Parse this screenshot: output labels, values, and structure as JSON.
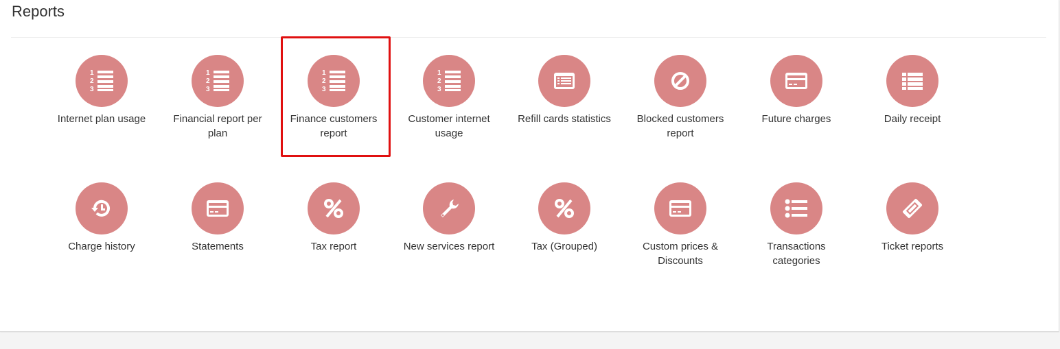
{
  "page": {
    "title": "Reports"
  },
  "reports": [
    {
      "label": "Internet plan usage",
      "icon": "ordered-list-icon"
    },
    {
      "label": "Financial report per plan",
      "icon": "ordered-list-icon"
    },
    {
      "label": "Finance customers report",
      "icon": "ordered-list-icon"
    },
    {
      "label": "Customer internet usage",
      "icon": "ordered-list-icon"
    },
    {
      "label": "Refill cards statistics",
      "icon": "list-alt-icon"
    },
    {
      "label": "Blocked customers report",
      "icon": "ban-icon"
    },
    {
      "label": "Future charges",
      "icon": "credit-card-icon"
    },
    {
      "label": "Daily receipt",
      "icon": "list-icon"
    },
    {
      "label": "Charge history",
      "icon": "history-icon"
    },
    {
      "label": "Statements",
      "icon": "credit-card-icon"
    },
    {
      "label": "Tax report",
      "icon": "percent-icon"
    },
    {
      "label": "New services report",
      "icon": "wrench-icon"
    },
    {
      "label": "Tax (Grouped)",
      "icon": "percent-icon"
    },
    {
      "label": "Custom prices & Discounts",
      "icon": "credit-card-icon"
    },
    {
      "label": "Transactions categories",
      "icon": "list-ul-icon"
    },
    {
      "label": "Ticket reports",
      "icon": "ticket-icon"
    }
  ],
  "selected": "Finance customers report",
  "colors": {
    "icon_bg": "#d98686",
    "highlight": "#e01010"
  }
}
